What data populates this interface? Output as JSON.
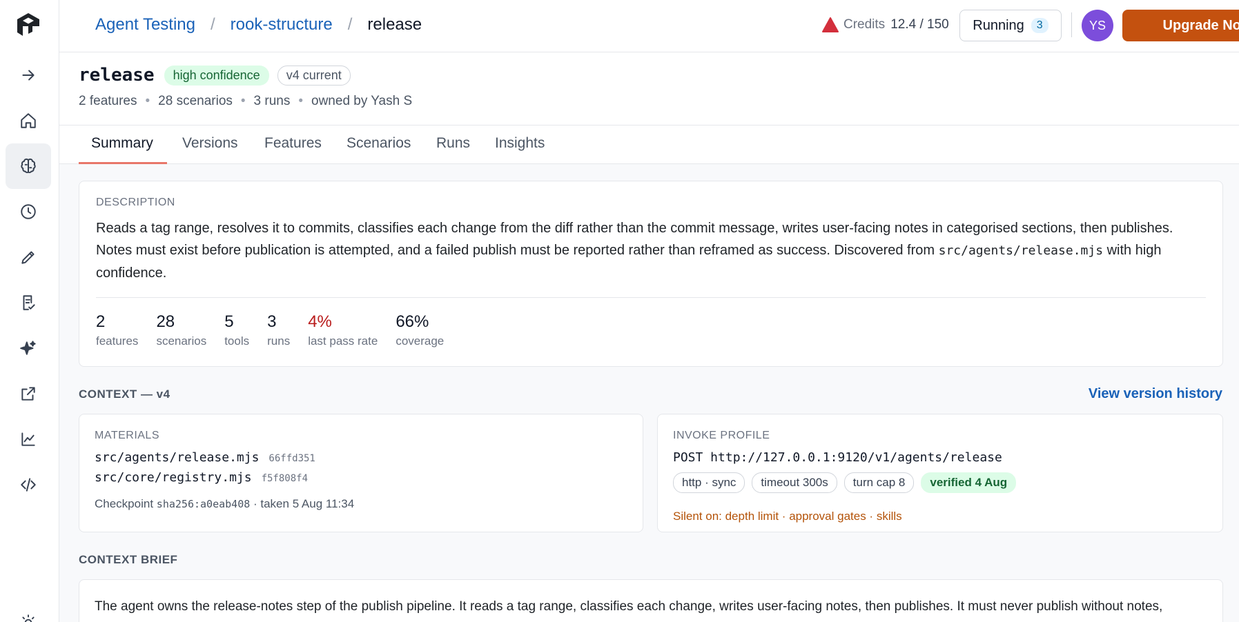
{
  "breadcrumb": {
    "items": [
      "Agent Testing",
      "rook-structure"
    ],
    "separator": "/",
    "current": "release"
  },
  "header": {
    "credits_label": "Credits",
    "credits_value": "12.4 / 150",
    "running_label": "Running",
    "running_count": "3",
    "avatar_initials": "YS",
    "upgrade_label": "Upgrade Now"
  },
  "agent": {
    "name": "release",
    "confidence_badge": "high confidence",
    "version_badge": "v4 current",
    "meta": [
      "2 features",
      "28 scenarios",
      "3 runs",
      "owned by Yash S"
    ]
  },
  "tabs": [
    "Summary",
    "Versions",
    "Features",
    "Scenarios",
    "Runs",
    "Insights"
  ],
  "description": {
    "label": "DESCRIPTION",
    "text_1": "Reads a tag range, resolves it to commits, classifies each change from the diff rather than the commit message, writes user-facing notes in categorised sections, then publishes. Notes must exist before publication is attempted, and a failed publish must be reported rather than reframed as success. Discovered from",
    "text_code": "src/agents/release.mjs",
    "text_2": "with high confidence."
  },
  "stats": [
    {
      "value": "2",
      "label": "features"
    },
    {
      "value": "28",
      "label": "scenarios"
    },
    {
      "value": "5",
      "label": "tools"
    },
    {
      "value": "3",
      "label": "runs"
    },
    {
      "value": "4%",
      "label": "last pass rate"
    },
    {
      "value": "66%",
      "label": "coverage"
    }
  ],
  "context": {
    "title": "CONTEXT — v4",
    "view_history": "View version history"
  },
  "materials": {
    "label": "MATERIALS",
    "files": [
      {
        "path": "src/agents/release.mjs",
        "hash": "66ffd351"
      },
      {
        "path": "src/core/registry.mjs",
        "hash": "f5f808f4"
      }
    ],
    "checkpoint_prefix": "Checkpoint",
    "checkpoint_hash": "sha256:a0eab408",
    "checkpoint_suffix": "· taken 5 Aug 11:34"
  },
  "invoke": {
    "label": "INVOKE PROFILE",
    "endpoint": "POST http://127.0.0.1:9120/v1/agents/release",
    "chips": [
      "http · sync",
      "timeout 300s",
      "turn cap 8"
    ],
    "verified": "verified 4 Aug",
    "silent": "Silent on: depth limit · approval gates · skills"
  },
  "brief": {
    "title": "CONTEXT BRIEF",
    "text": "The agent owns the release-notes step of the publish pipeline. It reads a tag range, classifies each change, writes user-facing notes, then publishes. It must never publish without notes,"
  },
  "colors": {
    "accent_link": "#1a62b8",
    "upgrade": "#c4510f",
    "tab_underline": "#e8776a",
    "pass_rate_red": "#b91c1c",
    "credits_icon": "#d32f3c",
    "avatar": "#7c4ddb"
  }
}
